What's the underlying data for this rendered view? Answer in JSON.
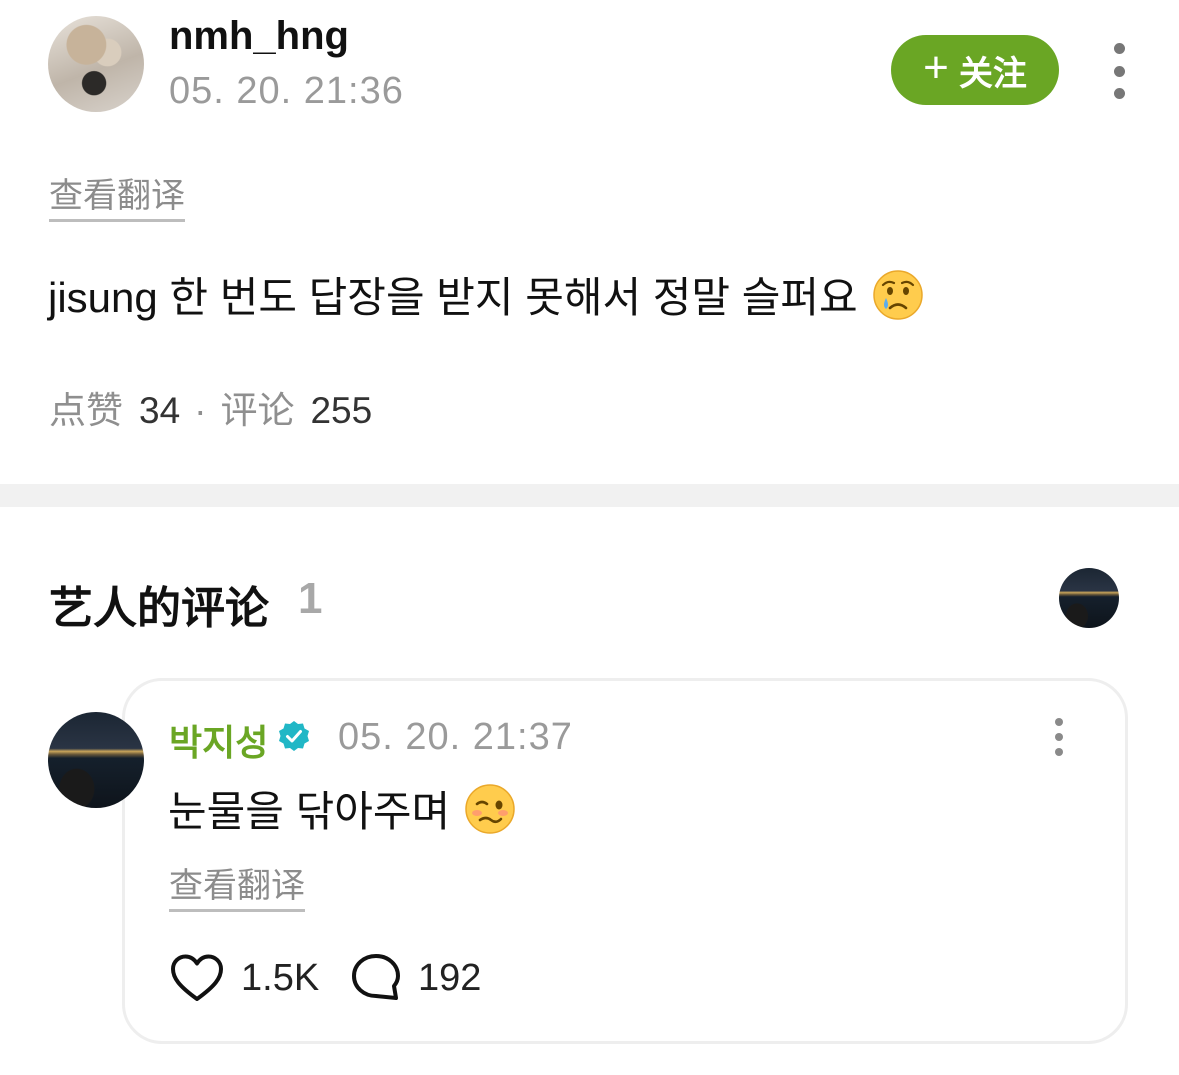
{
  "post": {
    "username": "nmh_hng",
    "timestamp": "05. 20. 21:36",
    "follow_label": "关注",
    "translate_label": "查看翻译",
    "text": "jisung 한 번도 답장을 받지 못해서 정말 슬퍼요",
    "text_emoji": "crying-face-emoji",
    "likes_label": "点赞",
    "likes_count": "34",
    "separator": "·",
    "comments_label": "评论",
    "comments_count": "255"
  },
  "artist_comments": {
    "title": "艺人的评论",
    "count": "1"
  },
  "comment": {
    "author": "박지성",
    "verified_icon": "verified-badge-icon",
    "timestamp": "05. 20. 21:37",
    "text": "눈물을 닦아주며",
    "text_emoji": "woozy-face-emoji",
    "translate_label": "查看翻译",
    "likes": "1.5K",
    "replies": "192"
  },
  "colors": {
    "accent_green": "#6aa624",
    "verified_teal": "#21b7c6",
    "muted_text": "#9a9a9a",
    "divider": "#f1f1f1"
  }
}
